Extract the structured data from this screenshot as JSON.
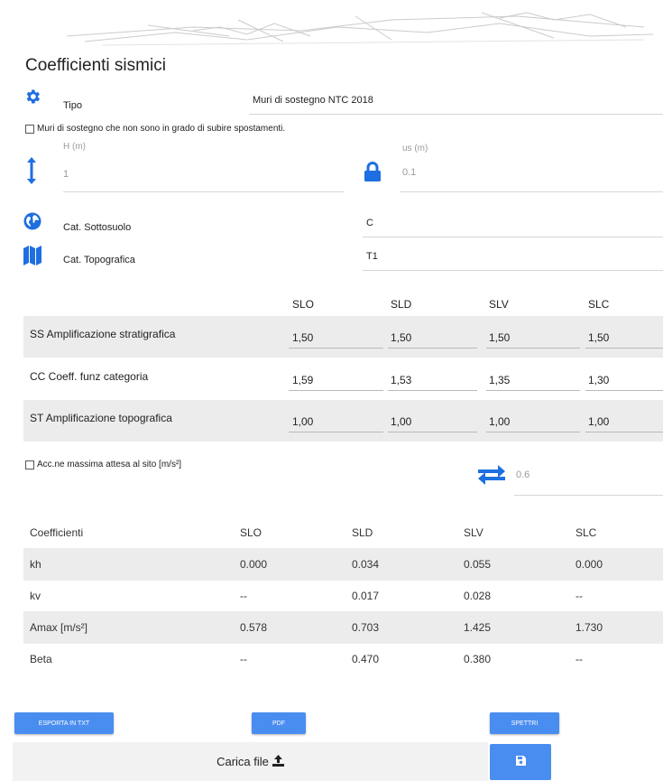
{
  "page": {
    "title": "Coefficienti sismici"
  },
  "tipo": {
    "label": "Tipo",
    "value": "Muri di sostegno NTC 2018"
  },
  "option_no_spostamenti": {
    "label": "Muri di sostegno che non sono in grado di subire spostamenti."
  },
  "h_field": {
    "label": "H (m)",
    "value": "1"
  },
  "us_field": {
    "label": "us (m)",
    "value": "0.1"
  },
  "sottosuolo": {
    "label": "Cat. Sottosuolo",
    "value": "C"
  },
  "topografica": {
    "label": "Cat. Topografica",
    "value": "T1"
  },
  "ss_table": {
    "headers": [
      "SLO",
      "SLD",
      "SLV",
      "SLC"
    ],
    "rows": [
      {
        "label": "SS Amplificazione stratigrafica",
        "values": [
          "1,50",
          "1,50",
          "1,50",
          "1,50"
        ]
      },
      {
        "label": "CC Coeff. funz categoria",
        "values": [
          "1,59",
          "1,53",
          "1,35",
          "1,30"
        ]
      },
      {
        "label": "ST Amplificazione topografica",
        "values": [
          "1,00",
          "1,00",
          "1,00",
          "1,00"
        ]
      }
    ]
  },
  "acc_option": {
    "label": "Acc.ne massima attesa al sito [m/s²]",
    "value": "0.6"
  },
  "coeff_table": {
    "headers": [
      "Coefficienti",
      "SLO",
      "SLD",
      "SLV",
      "SLC"
    ],
    "rows": [
      [
        "kh",
        "0.000",
        "0.034",
        "0.055",
        "0.000"
      ],
      [
        "kv",
        "--",
        "0.017",
        "0.028",
        "--"
      ],
      [
        "Amax [m/s²]",
        "0.578",
        "0.703",
        "1.425",
        "1.730"
      ],
      [
        "Beta",
        "--",
        "0.470",
        "0.380",
        "--"
      ]
    ]
  },
  "buttons": {
    "export_txt": "Esporta in TXT",
    "pdf": "PDF",
    "spettri": "Spettri"
  },
  "upload": {
    "label": "Carica file"
  },
  "colors": {
    "accent": "#1e6fe0",
    "button": "#4a8df0"
  }
}
